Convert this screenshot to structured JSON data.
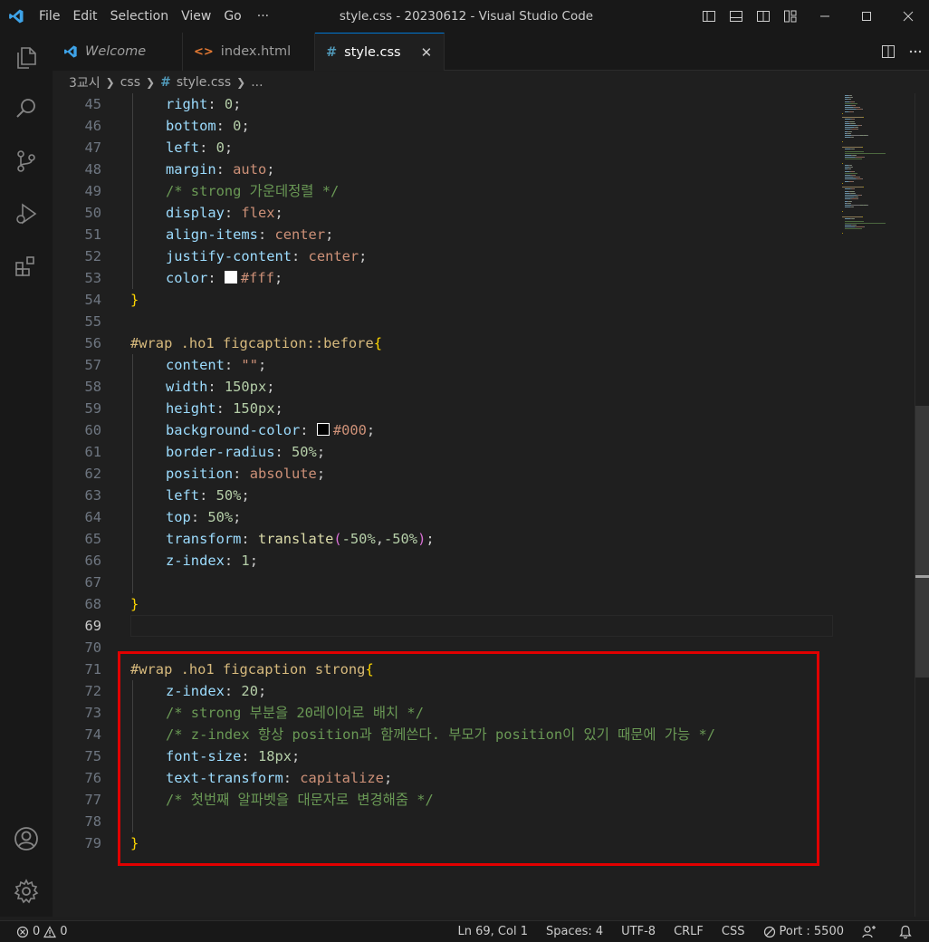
{
  "window": {
    "title": "style.css - 20230612 - Visual Studio Code"
  },
  "menu": [
    "File",
    "Edit",
    "Selection",
    "View",
    "Go",
    "···"
  ],
  "tabs": [
    {
      "label": "Welcome",
      "icon": "vscode-icon",
      "active": false
    },
    {
      "label": "index.html",
      "icon": "html-icon",
      "active": false
    },
    {
      "label": "style.css",
      "icon": "css-icon",
      "active": true,
      "close": "✕"
    }
  ],
  "breadcrumb": {
    "folder": "3교시",
    "subfolder": "css",
    "hash": "#",
    "file": "style.css",
    "more": "..."
  },
  "editor": {
    "lines": [
      {
        "n": "45",
        "indent": 1,
        "tokens": [
          [
            "prop",
            "right"
          ],
          [
            "punc",
            ": "
          ],
          [
            "num",
            "0"
          ],
          [
            "punc",
            ";"
          ]
        ]
      },
      {
        "n": "46",
        "indent": 1,
        "tokens": [
          [
            "prop",
            "bottom"
          ],
          [
            "punc",
            ": "
          ],
          [
            "num",
            "0"
          ],
          [
            "punc",
            ";"
          ]
        ]
      },
      {
        "n": "47",
        "indent": 1,
        "tokens": [
          [
            "prop",
            "left"
          ],
          [
            "punc",
            ": "
          ],
          [
            "num",
            "0"
          ],
          [
            "punc",
            ";"
          ]
        ]
      },
      {
        "n": "48",
        "indent": 1,
        "tokens": [
          [
            "prop",
            "margin"
          ],
          [
            "punc",
            ": "
          ],
          [
            "kw",
            "auto"
          ],
          [
            "punc",
            ";"
          ]
        ]
      },
      {
        "n": "49",
        "indent": 1,
        "tokens": [
          [
            "com",
            "/* strong 가운데정렬 */"
          ]
        ]
      },
      {
        "n": "50",
        "indent": 1,
        "tokens": [
          [
            "prop",
            "display"
          ],
          [
            "punc",
            ": "
          ],
          [
            "kw",
            "flex"
          ],
          [
            "punc",
            ";"
          ]
        ]
      },
      {
        "n": "51",
        "indent": 1,
        "tokens": [
          [
            "prop",
            "align-items"
          ],
          [
            "punc",
            ": "
          ],
          [
            "kw",
            "center"
          ],
          [
            "punc",
            ";"
          ]
        ]
      },
      {
        "n": "52",
        "indent": 1,
        "tokens": [
          [
            "prop",
            "justify-content"
          ],
          [
            "punc",
            ": "
          ],
          [
            "kw",
            "center"
          ],
          [
            "punc",
            ";"
          ]
        ]
      },
      {
        "n": "53",
        "indent": 1,
        "tokens": [
          [
            "prop",
            "color"
          ],
          [
            "punc",
            ": "
          ],
          [
            "swatch",
            "#ffffff"
          ],
          [
            "kw",
            "#fff"
          ],
          [
            "punc",
            ";"
          ]
        ]
      },
      {
        "n": "54",
        "indent": 0,
        "tokens": [
          [
            "brace",
            "}"
          ]
        ]
      },
      {
        "n": "55",
        "indent": 0,
        "tokens": []
      },
      {
        "n": "56",
        "indent": 0,
        "tokens": [
          [
            "sel",
            "#wrap .ho1 figcaption::before"
          ],
          [
            "brace",
            "{"
          ]
        ]
      },
      {
        "n": "57",
        "indent": 1,
        "tokens": [
          [
            "prop",
            "content"
          ],
          [
            "punc",
            ": "
          ],
          [
            "kw",
            "\"\""
          ],
          [
            "punc",
            ";"
          ]
        ]
      },
      {
        "n": "58",
        "indent": 1,
        "tokens": [
          [
            "prop",
            "width"
          ],
          [
            "punc",
            ": "
          ],
          [
            "num",
            "150px"
          ],
          [
            "punc",
            ";"
          ]
        ]
      },
      {
        "n": "59",
        "indent": 1,
        "tokens": [
          [
            "prop",
            "height"
          ],
          [
            "punc",
            ": "
          ],
          [
            "num",
            "150px"
          ],
          [
            "punc",
            ";"
          ]
        ]
      },
      {
        "n": "60",
        "indent": 1,
        "tokens": [
          [
            "prop",
            "background-color"
          ],
          [
            "punc",
            ": "
          ],
          [
            "swatch",
            "#000000"
          ],
          [
            "kw",
            "#000"
          ],
          [
            "punc",
            ";"
          ]
        ]
      },
      {
        "n": "61",
        "indent": 1,
        "tokens": [
          [
            "prop",
            "border-radius"
          ],
          [
            "punc",
            ": "
          ],
          [
            "num",
            "50%"
          ],
          [
            "punc",
            ";"
          ]
        ]
      },
      {
        "n": "62",
        "indent": 1,
        "tokens": [
          [
            "prop",
            "position"
          ],
          [
            "punc",
            ": "
          ],
          [
            "kw",
            "absolute"
          ],
          [
            "punc",
            ";"
          ]
        ]
      },
      {
        "n": "63",
        "indent": 1,
        "tokens": [
          [
            "prop",
            "left"
          ],
          [
            "punc",
            ": "
          ],
          [
            "num",
            "50%"
          ],
          [
            "punc",
            ";"
          ]
        ]
      },
      {
        "n": "64",
        "indent": 1,
        "tokens": [
          [
            "prop",
            "top"
          ],
          [
            "punc",
            ": "
          ],
          [
            "num",
            "50%"
          ],
          [
            "punc",
            ";"
          ]
        ]
      },
      {
        "n": "65",
        "indent": 1,
        "tokens": [
          [
            "prop",
            "transform"
          ],
          [
            "punc",
            ": "
          ],
          [
            "fn",
            "translate"
          ],
          [
            "paren",
            "("
          ],
          [
            "num",
            "-50%"
          ],
          [
            "punc",
            ","
          ],
          [
            "num",
            "-50%"
          ],
          [
            "paren",
            ")"
          ],
          [
            "punc",
            ";"
          ]
        ]
      },
      {
        "n": "66",
        "indent": 1,
        "tokens": [
          [
            "prop",
            "z-index"
          ],
          [
            "punc",
            ": "
          ],
          [
            "num",
            "1"
          ],
          [
            "punc",
            ";"
          ]
        ]
      },
      {
        "n": "67",
        "indent": 1,
        "tokens": []
      },
      {
        "n": "68",
        "indent": 0,
        "tokens": [
          [
            "brace",
            "}"
          ]
        ]
      },
      {
        "n": "69",
        "indent": 0,
        "tokens": [],
        "current": true
      },
      {
        "n": "70",
        "indent": 0,
        "tokens": []
      },
      {
        "n": "71",
        "indent": 0,
        "tokens": [
          [
            "sel",
            "#wrap .ho1 figcaption strong"
          ],
          [
            "brace",
            "{"
          ]
        ]
      },
      {
        "n": "72",
        "indent": 1,
        "tokens": [
          [
            "prop",
            "z-index"
          ],
          [
            "punc",
            ": "
          ],
          [
            "num",
            "20"
          ],
          [
            "punc",
            ";"
          ]
        ]
      },
      {
        "n": "73",
        "indent": 1,
        "tokens": [
          [
            "com",
            "/* strong 부분을 20레이어로 배치 */"
          ]
        ]
      },
      {
        "n": "74",
        "indent": 1,
        "tokens": [
          [
            "com",
            "/* z-index 항상 position과 함께쓴다. 부모가 position이 있기 때문에 가능 */"
          ]
        ]
      },
      {
        "n": "75",
        "indent": 1,
        "tokens": [
          [
            "prop",
            "font-size"
          ],
          [
            "punc",
            ": "
          ],
          [
            "num",
            "18px"
          ],
          [
            "punc",
            ";"
          ]
        ]
      },
      {
        "n": "76",
        "indent": 1,
        "tokens": [
          [
            "prop",
            "text-transform"
          ],
          [
            "punc",
            ": "
          ],
          [
            "kw",
            "capitalize"
          ],
          [
            "punc",
            ";"
          ]
        ]
      },
      {
        "n": "77",
        "indent": 1,
        "tokens": [
          [
            "com",
            "/* 첫번째 알파벳을 대문자로 변경해줌 */"
          ]
        ]
      },
      {
        "n": "78",
        "indent": 1,
        "tokens": []
      },
      {
        "n": "79",
        "indent": 0,
        "tokens": [
          [
            "brace",
            "}"
          ]
        ]
      }
    ]
  },
  "status": {
    "errors": "0",
    "warnings": "0",
    "position": "Ln 69, Col 1",
    "spaces": "Spaces: 4",
    "encoding": "UTF-8",
    "eol": "CRLF",
    "language": "CSS",
    "port": "Port : 5500"
  },
  "colors": {
    "accent": "#0078d4",
    "highlight_box": "#e10000"
  }
}
